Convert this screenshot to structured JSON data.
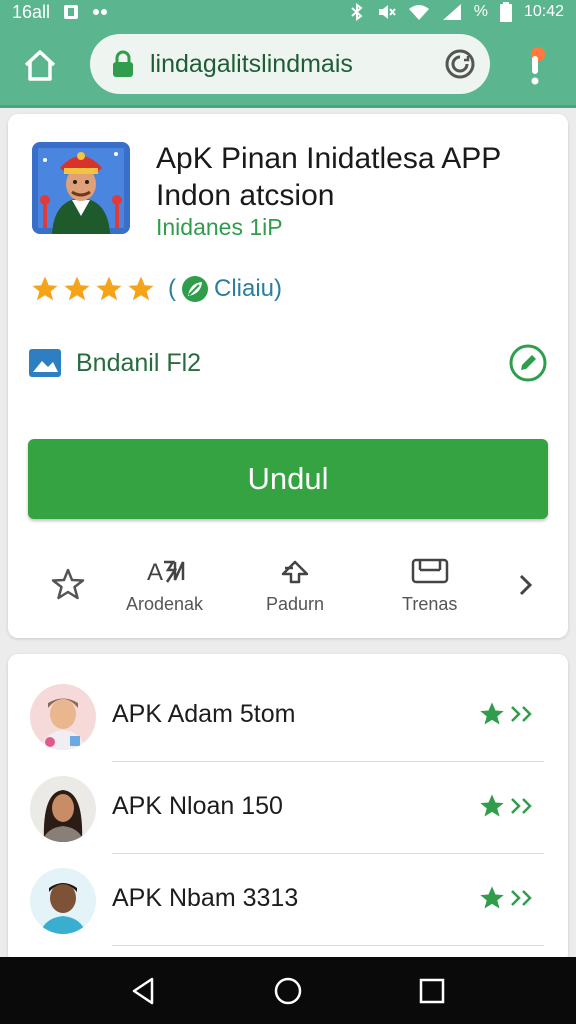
{
  "status_bar": {
    "left_text": "16all",
    "percent": "%",
    "time": "10:42"
  },
  "browser": {
    "url": "lindagalitslindmais"
  },
  "app": {
    "title": "ApK Pinan Inidatlesa APP Indon atcsion",
    "developer": "Inidanes 1iP",
    "rating_stars": 4,
    "rating_text": "Cliaiu",
    "file_label": "Bndanil Fl2",
    "download_label": "Undul"
  },
  "actions": [
    {
      "label": ""
    },
    {
      "label": "Arodenak"
    },
    {
      "label": "Padurn"
    },
    {
      "label": "Trenas"
    }
  ],
  "list": [
    {
      "name": "APK Adam 5tom"
    },
    {
      "name": "APK Nloan 150"
    },
    {
      "name": "APK Nbam 3313"
    }
  ],
  "colors": {
    "accent": "#5bb58f",
    "primary_button": "#36a342",
    "star_gold": "#f4a31b",
    "green_text": "#2f9d4c"
  },
  "icons": [
    "home-icon",
    "lock-icon",
    "reload-icon",
    "alert-icon",
    "star-icon",
    "leaf-icon",
    "file-icon",
    "edit-icon",
    "chevron-right-icon",
    "back-icon",
    "circle-home-icon",
    "recent-icon"
  ]
}
